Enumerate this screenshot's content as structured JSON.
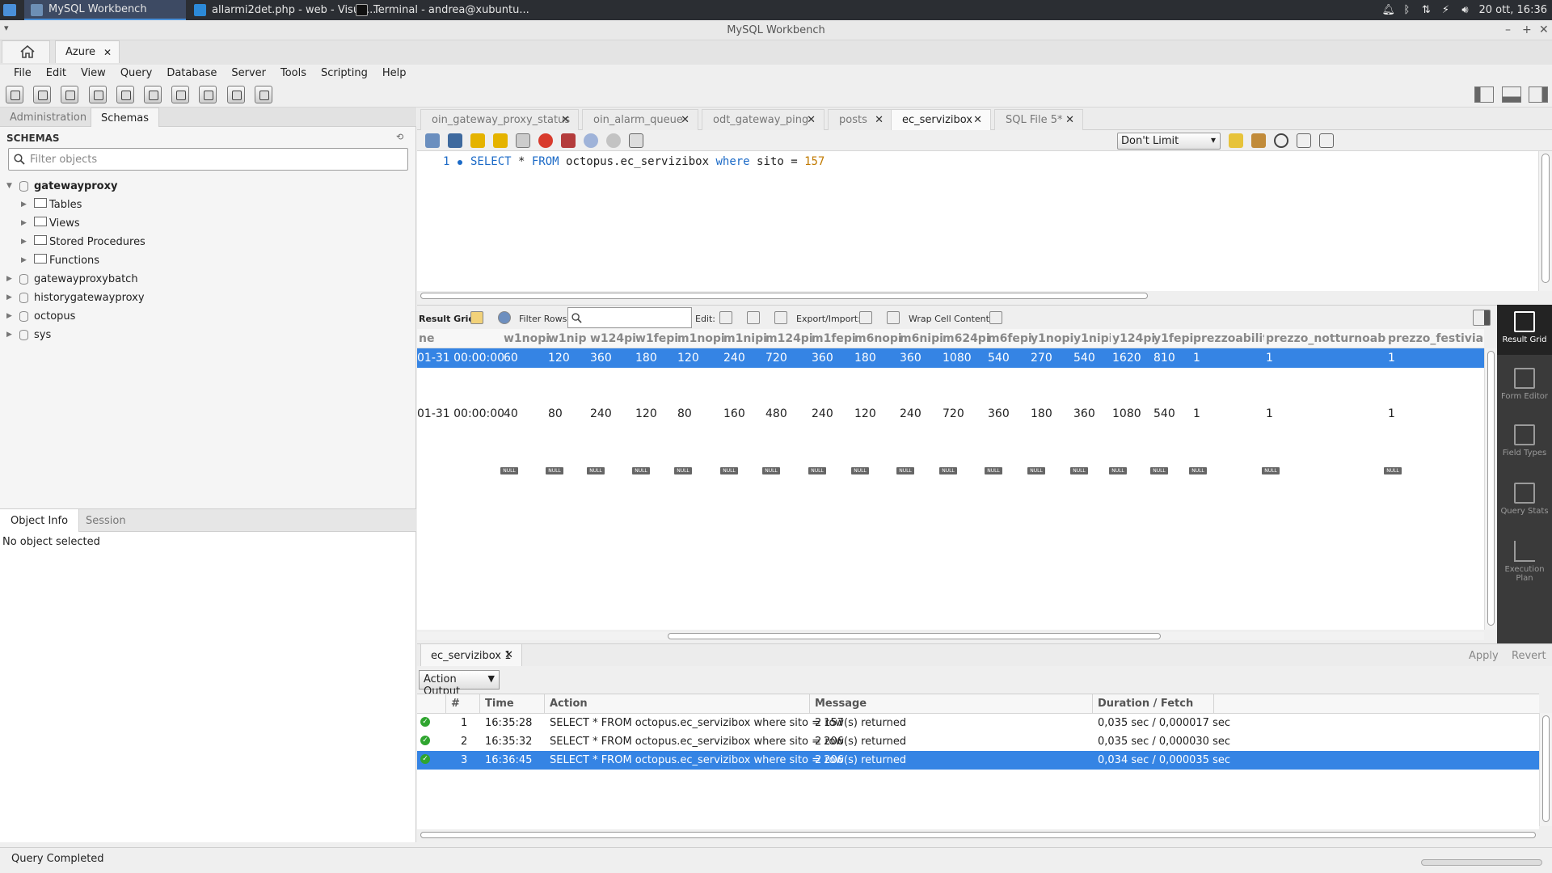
{
  "taskbar": {
    "tasks": [
      {
        "label": "MySQL Workbench"
      },
      {
        "label": "allarmi2det.php - web - Visua..."
      },
      {
        "label": "Terminal - andrea@xubuntu..."
      }
    ],
    "clock": "20 ott, 16:36"
  },
  "window": {
    "title": "MySQL Workbench"
  },
  "conn_tab": {
    "label": "Azure"
  },
  "menu": [
    "File",
    "Edit",
    "View",
    "Query",
    "Database",
    "Server",
    "Tools",
    "Scripting",
    "Help"
  ],
  "sidebar": {
    "tabs": [
      "Administration",
      "Schemas"
    ],
    "schemas_header": "SCHEMAS",
    "filter_placeholder": "Filter objects",
    "schemas": [
      "gatewayproxy",
      "gatewayproxybatch",
      "historygatewayproxy",
      "octopus",
      "sys"
    ],
    "children": [
      "Tables",
      "Views",
      "Stored Procedures",
      "Functions"
    ]
  },
  "object_info": {
    "tabs": [
      "Object Info",
      "Session"
    ],
    "text": "No object selected"
  },
  "editor_tabs": [
    {
      "label": "oin_gateway_proxy_status"
    },
    {
      "label": "oin_alarm_queue"
    },
    {
      "label": "odt_gateway_ping"
    },
    {
      "label": "posts"
    },
    {
      "label": "ec_servizibox"
    },
    {
      "label": "SQL File 5*"
    }
  ],
  "sql_toolbar": {
    "limit": "Don't Limit"
  },
  "editor": {
    "line_number": "1",
    "code": {
      "k1": "SELECT",
      "star": " * ",
      "k2": "FROM",
      "table": " octopus.ec_servizibox ",
      "k3": "where",
      "cond": " sito = ",
      "num": "157"
    }
  },
  "result_toolbar": {
    "result_grid": "Result Grid",
    "filter_rows": "Filter Rows:",
    "edit": "Edit:",
    "export": "Export/Import:",
    "wrap": "Wrap Cell Content:"
  },
  "grid": {
    "columns": [
      "ne",
      "w1nopi",
      "w1nipi",
      "w124pi",
      "w1fepi",
      "m1nopi",
      "m1nipi",
      "m124pi",
      "m1fepi",
      "m6nopi",
      "m6nipi",
      "m624pi",
      "m6fepi",
      "y1nopi",
      "y1nipi",
      "y124pi",
      "y1fepi",
      "prezzoabilita",
      "prezzo_notturnoabili",
      "prezzo_festiviabi"
    ],
    "rows": [
      [
        "01-31 00:00:00",
        "60",
        "120",
        "360",
        "180",
        "120",
        "240",
        "720",
        "360",
        "180",
        "360",
        "1080",
        "540",
        "270",
        "540",
        "1620",
        "810",
        "1",
        "1",
        "1"
      ],
      [
        "01-31 00:00:00",
        "40",
        "80",
        "240",
        "120",
        "80",
        "160",
        "480",
        "240",
        "120",
        "240",
        "720",
        "360",
        "180",
        "360",
        "1080",
        "540",
        "1",
        "1",
        "1"
      ]
    ],
    "null_label": "NULL"
  },
  "right_panel": [
    "Result Grid",
    "Form Editor",
    "Field Types",
    "Query Stats",
    "Execution Plan"
  ],
  "result_tab": {
    "label": "ec_servizibox 1"
  },
  "apply_label": "Apply",
  "revert_label": "Revert",
  "output": {
    "selector": "Action Output",
    "headers": [
      "#",
      "Time",
      "Action",
      "Message",
      "Duration / Fetch"
    ],
    "rows": [
      {
        "n": "1",
        "time": "16:35:28",
        "action": "SELECT * FROM octopus.ec_servizibox where sito = 157",
        "message": "2 row(s) returned",
        "duration": "0,035 sec / 0,000017 sec"
      },
      {
        "n": "2",
        "time": "16:35:32",
        "action": "SELECT * FROM octopus.ec_servizibox where sito = 206",
        "message": "2 row(s) returned",
        "duration": "0,035 sec / 0,000030 sec"
      },
      {
        "n": "3",
        "time": "16:36:45",
        "action": "SELECT * FROM octopus.ec_servizibox where sito = 206",
        "message": "2 row(s) returned",
        "duration": "0,034 sec / 0,000035 sec"
      }
    ]
  },
  "status": "Query Completed",
  "colors": {
    "selection": "#3584e4",
    "keyword": "#1b6ac7",
    "number": "#c17a00",
    "taskbar": "#2b2e33"
  }
}
